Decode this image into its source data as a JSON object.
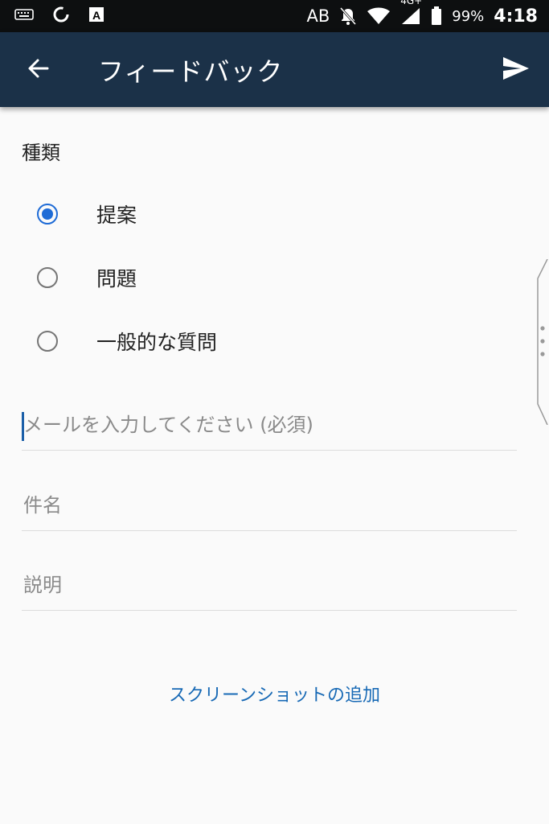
{
  "status_bar": {
    "icons": [
      "keyboard-icon",
      "sync-icon",
      "a-box-icon",
      "mute-bell-icon",
      "wifi-icon",
      "signal-icon",
      "battery-icon"
    ],
    "carrier_text": "AB",
    "network": "4G+",
    "battery": "99%",
    "time": "4:18"
  },
  "appbar": {
    "title": "フィードバック",
    "back_icon": "arrow-left-icon",
    "send_icon": "send-icon",
    "background": "#1b3148"
  },
  "form": {
    "type_label": "種類",
    "options": [
      {
        "label": "提案",
        "checked": true
      },
      {
        "label": "問題",
        "checked": false
      },
      {
        "label": "一般的な質問",
        "checked": false
      }
    ],
    "email": {
      "value": "",
      "placeholder": "メールを入力してください (必須)"
    },
    "subject": {
      "value": "",
      "placeholder": "件名"
    },
    "description": {
      "value": "",
      "placeholder": "説明"
    },
    "add_screenshot": "スクリーンショットの追加"
  },
  "colors": {
    "accent": "#1e6bd6",
    "link": "#1769b5"
  }
}
